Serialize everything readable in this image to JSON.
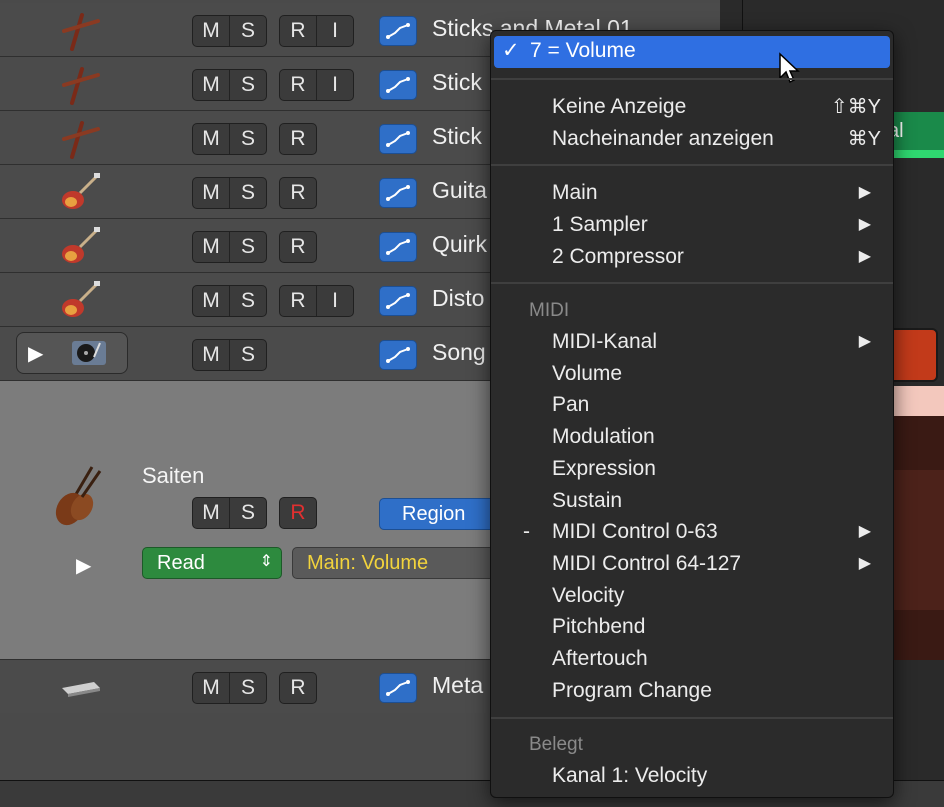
{
  "tracks": [
    {
      "name": "Sticks and Metal 01",
      "icon": "drumsticks-icon",
      "buttons": [
        "M",
        "S",
        "R",
        "I"
      ]
    },
    {
      "name": "Stick",
      "icon": "drumsticks-icon",
      "buttons": [
        "M",
        "S",
        "R",
        "I"
      ]
    },
    {
      "name": "Stick",
      "icon": "drumsticks-icon",
      "buttons": [
        "M",
        "S",
        "R"
      ]
    },
    {
      "name": "Guita",
      "icon": "electric-guitar-icon",
      "buttons": [
        "M",
        "S",
        "R"
      ]
    },
    {
      "name": "Quirk",
      "icon": "electric-guitar-icon",
      "buttons": [
        "M",
        "S",
        "R"
      ]
    },
    {
      "name": "Disto",
      "icon": "electric-guitar-icon",
      "buttons": [
        "M",
        "S",
        "R",
        "I"
      ]
    },
    {
      "name": "Song",
      "icon": "turntable-icon",
      "buttons": [
        "M",
        "S"
      ]
    }
  ],
  "expanded_track": {
    "name": "Saiten",
    "icon": "violin-icon",
    "buttons": [
      "M",
      "S",
      "R"
    ],
    "region_button": "Region",
    "automation_mode": "Read",
    "automation_param": "Main: Volume"
  },
  "last_track": {
    "name": "Meta",
    "icon": "keyboard-icon",
    "buttons": [
      "M",
      "S",
      "R"
    ]
  },
  "menu": {
    "selected": "7 = Volume",
    "check": "✓",
    "items_top": [
      {
        "label": "Keine Anzeige",
        "shortcut": "⇧⌘Y"
      },
      {
        "label": "Nacheinander anzeigen",
        "shortcut": "⌘Y"
      }
    ],
    "items_plugins": [
      {
        "label": "Main",
        "submenu": "▶"
      },
      {
        "label": "1 Sampler",
        "submenu": "▶"
      },
      {
        "label": "2 Compressor",
        "submenu": "▶"
      }
    ],
    "midi_header": "MIDI",
    "items_midi": [
      {
        "label": "MIDI-Kanal",
        "submenu": "▶",
        "mark": ""
      },
      {
        "label": "Volume",
        "submenu": "",
        "mark": ""
      },
      {
        "label": "Pan",
        "submenu": "",
        "mark": ""
      },
      {
        "label": "Modulation",
        "submenu": "",
        "mark": ""
      },
      {
        "label": "Expression",
        "submenu": "",
        "mark": ""
      },
      {
        "label": "Sustain",
        "submenu": "",
        "mark": ""
      },
      {
        "label": "MIDI Control 0-63",
        "submenu": "▶",
        "mark": "-"
      },
      {
        "label": "MIDI Control 64-127",
        "submenu": "▶",
        "mark": ""
      },
      {
        "label": "Velocity",
        "submenu": "",
        "mark": ""
      },
      {
        "label": "Pitchbend",
        "submenu": "",
        "mark": ""
      },
      {
        "label": "Aftertouch",
        "submenu": "",
        "mark": ""
      },
      {
        "label": "Program Change",
        "submenu": "",
        "mark": ""
      }
    ],
    "belegt_header": "Belegt",
    "items_belegt": [
      {
        "label": "Kanal 1: Velocity"
      }
    ]
  },
  "right_panel": {
    "green_region_label": "al"
  },
  "colors": {
    "accent_blue": "#2f6fe2",
    "read_green": "#2d8a3e",
    "param_yellow": "#f2d33c",
    "record_red": "#e03030"
  }
}
